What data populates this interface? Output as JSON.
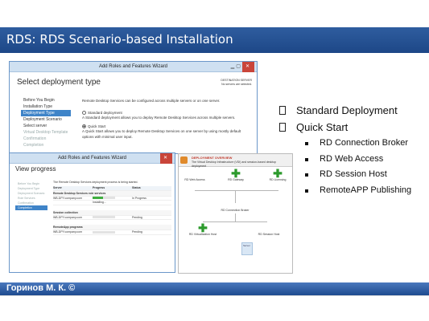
{
  "slide": {
    "title": "RDS: RDS Scenario-based Installation",
    "footer": "Горинов М. К. ©",
    "header_color": "#24508f"
  },
  "bullets": {
    "main": [
      "Standard Deployment",
      "Quick Start"
    ],
    "sub": [
      "RD Connection Broker",
      "RD Web Access",
      "RD Session Host",
      "RemoteAPP Publishing"
    ]
  },
  "wizard": {
    "title": "Add Roles and Features Wizard",
    "heading": "Select deployment type",
    "dest_label": "DESTINATION SERVER",
    "dest_value": "No servers are selected.",
    "steps": [
      "Before You Begin",
      "Installation Type",
      "Deployment Type",
      "Deployment Scenario",
      "Select server",
      "Virtual Desktop Template",
      "Confirmation",
      "Completion"
    ],
    "active_step": 2,
    "intro": "Remote Desktop Services can be configured across multiple servers or on one server.",
    "option1": "Standard deployment",
    "option1_desc": "A Standard deployment allows you to deploy Remote Desktop Services across multiple servers.",
    "option2": "Quick Start",
    "option2_desc": "A Quick Start allows you to deploy Remote Desktop Services on one server by using mostly default options with minimal user input.",
    "selected": "Quick Start"
  },
  "progress_window": {
    "title": "Add Roles and Features Wizard",
    "heading": "View progress",
    "steps": [
      "Before You Begin",
      "Deployment Type",
      "Deployment Scenario",
      "Role Services",
      "Confirmation",
      "Completion"
    ],
    "active_step": 5,
    "caption": "The Remote Desktop Services deployment process is being started.",
    "columns": [
      "Server",
      "Progress",
      "Status"
    ],
    "sections": [
      {
        "name": "Remote Desktop Services role services",
        "rows": [
          {
            "server": "WB-DPY.company.com",
            "status": "In Progress",
            "progress": 0.45,
            "note": "Installing..."
          }
        ]
      },
      {
        "name": "Session collection",
        "rows": [
          {
            "server": "WB-DPY.company.com",
            "status": "Pending",
            "progress": 0.0,
            "note": ""
          }
        ]
      },
      {
        "name": "RemoteApp programs",
        "rows": [
          {
            "server": "WB-DPY.company.com",
            "status": "Pending",
            "progress": 0.0,
            "note": ""
          }
        ]
      }
    ]
  },
  "overview": {
    "section": "DEPLOYMENT OVERVIEW",
    "subtitle": "The Virtual Desktop Infrastructure (VDI) and session-based desktop deployment",
    "nodes": [
      "RD Web Access",
      "RD Gateway",
      "RD Licensing",
      "RD Connection Broker",
      "RD Virtualization Host",
      "RD Session Host"
    ],
    "tooltip": "Server"
  }
}
